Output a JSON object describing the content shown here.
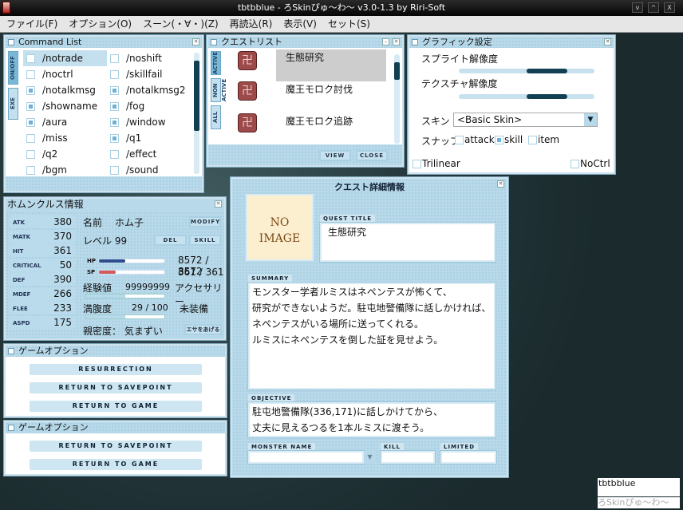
{
  "window": {
    "title": "tbtbblue - ろSkinぴゅ〜わ〜 v3.0-1.3 by Riri-Soft",
    "controls": [
      "v",
      "^",
      "X"
    ]
  },
  "menu": [
    "ファイル(F)",
    "オプション(O)",
    "スーン(・∀・)(Z)",
    "再読込(R)",
    "表示(V)",
    "セット(S)"
  ],
  "command_list": {
    "title": "Command List",
    "tabs": [
      "ON/OFF",
      "EXE"
    ],
    "items": [
      {
        "label": "/notrade",
        "checked": false,
        "selected": true
      },
      {
        "label": "/noshift",
        "checked": false
      },
      {
        "label": "/noctrl",
        "checked": false
      },
      {
        "label": "/skillfail",
        "checked": false
      },
      {
        "label": "/notalkmsg",
        "checked": true
      },
      {
        "label": "/notalkmsg2",
        "checked": true
      },
      {
        "label": "/showname",
        "checked": true
      },
      {
        "label": "/fog",
        "checked": true
      },
      {
        "label": "/aura",
        "checked": true
      },
      {
        "label": "/window",
        "checked": true
      },
      {
        "label": "/miss",
        "checked": false
      },
      {
        "label": "/q1",
        "checked": true
      },
      {
        "label": "/q2",
        "checked": false
      },
      {
        "label": "/effect",
        "checked": false
      },
      {
        "label": "/bgm",
        "checked": false
      },
      {
        "label": "/sound",
        "checked": false
      }
    ]
  },
  "quest_list": {
    "title": "クエストリスト",
    "tabs": [
      "ACTIVE",
      "NON ACTIVE",
      "ALL"
    ],
    "items": [
      "生態研究",
      "魔王モロク討伐",
      "魔王モロク追跡"
    ],
    "selected": 0,
    "view": "VIEW",
    "close": "CLOSE"
  },
  "graphics": {
    "title": "グラフィック設定",
    "sprite_label": "スプライト解像度",
    "sprite_level": 0.6,
    "texture_label": "テクスチャ解像度",
    "texture_level": 0.6,
    "skin_label": "スキン",
    "skin_value": "<Basic Skin>",
    "snap_label": "スナップ",
    "snap": [
      {
        "label": "attack",
        "checked": false
      },
      {
        "label": "skill",
        "checked": true
      },
      {
        "label": "item",
        "checked": false
      }
    ],
    "trilinear": "Trilinear",
    "noctrl": "NoCtrl"
  },
  "homunculus": {
    "title": "ホムンクルス情報",
    "stats": [
      {
        "k": "ATK",
        "v": "380"
      },
      {
        "k": "MATK",
        "v": "370"
      },
      {
        "k": "HIT",
        "v": "361"
      },
      {
        "k": "CRITICAL",
        "v": "50"
      },
      {
        "k": "DEF",
        "v": "390"
      },
      {
        "k": "MDEF",
        "v": "266"
      },
      {
        "k": "FLEE",
        "v": "233"
      },
      {
        "k": "ASPD",
        "v": "175"
      }
    ],
    "name_label": "名前",
    "name": "ホム子",
    "level": "レベル 99",
    "modify": "MODIFY",
    "del": "DEL",
    "skill": "SKILL",
    "hp_label": "HP",
    "hp": "8572 / 8572",
    "hp_bar": 0.4,
    "hp_color": "#2b4f8e",
    "sp_label": "SP",
    "sp": "361 / 361",
    "sp_bar": 0.25,
    "sp_color": "#d25a5a",
    "exp_label": "経験値",
    "exp": "99999999",
    "exp_bar": 0.5,
    "accessory_label": "アクセサリー",
    "accessory": "未装備",
    "hunger_label": "満腹度",
    "hunger": "29 / 100",
    "hunger_bar": 0.5,
    "intimacy": "親密度： 気まずい",
    "feed": "エサをあげる"
  },
  "game_options_1": {
    "title": "ゲームオプション",
    "buttons": [
      "RESURRECTION",
      "RETURN TO SAVEPOINT",
      "RETURN TO GAME"
    ]
  },
  "game_options_2": {
    "title": "ゲームオプション",
    "buttons": [
      "RETURN TO SAVEPOINT",
      "RETURN TO GAME"
    ]
  },
  "quest_detail": {
    "title": "クエスト詳細情報",
    "no_image": [
      "NO",
      "IMAGE"
    ],
    "title_label": "QUEST TITLE",
    "quest_title": "生態研究",
    "summary_label": "SUMMARY",
    "summary": [
      "モンスター学者ルミスはネペンテスが怖くて、",
      "研究ができないようだ。駐屯地警備隊に話しかければ、",
      "ネペンテスがいる場所に送ってくれる。",
      "ルミスにネペンテスを倒した証を見せよう。"
    ],
    "objective_label": "OBJECTIVE",
    "objective": [
      "駐屯地警備隊(336,171)に話しかけてから、",
      "丈夫に見えるつるを1本ルミスに渡そう。"
    ],
    "monster_label": "MONSTER NAME",
    "kill_label": "KILL",
    "limited_label": "LIMITED"
  },
  "corner": {
    "name": "tbtbblue",
    "skin": "ろSkinぴゅ〜わ〜"
  }
}
